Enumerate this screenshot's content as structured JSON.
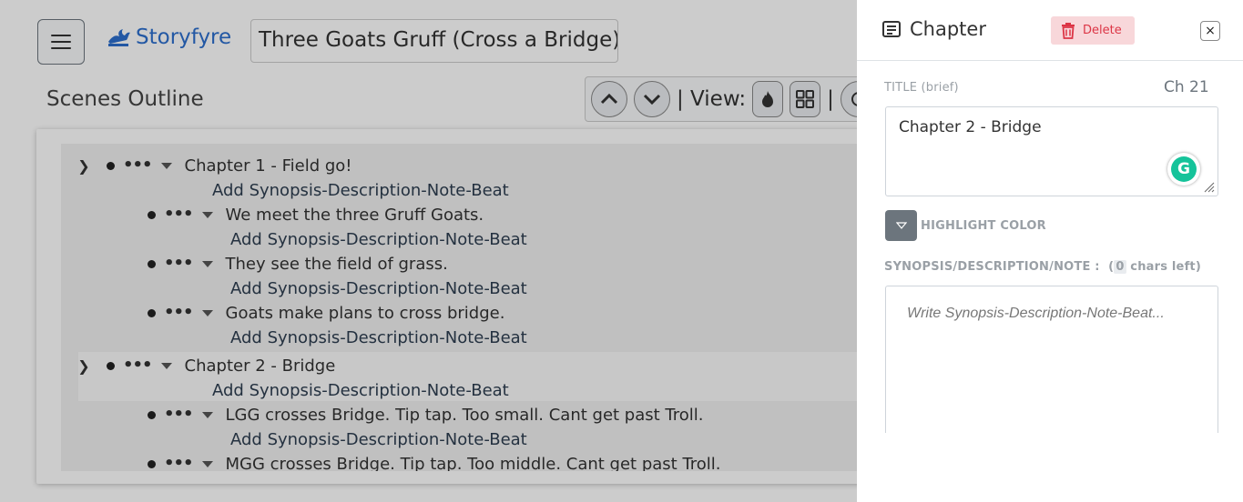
{
  "header": {
    "brand": "Storyfyre",
    "project_title": "Three Goats Gruff (Cross a Bridge)"
  },
  "outline": {
    "heading": "Scenes Outline",
    "toolbar_view_label": "| View:",
    "toolbar_sep": "|",
    "add_synopsis_label": "Add Synopsis-Description-Note-Beat",
    "chapters": [
      {
        "title": "Chapter 1 - Field go!",
        "add_label": "Add Synopsis-Description-Note-Beat",
        "scenes": [
          {
            "title": "We meet the three Gruff Goats.",
            "add_label": "Add Synopsis-Description-Note-Beat"
          },
          {
            "title": "They see the field of grass.",
            "add_label": "Add Synopsis-Description-Note-Beat"
          },
          {
            "title": "Goats make plans to cross bridge.",
            "add_label": "Add Synopsis-Description-Note-Beat"
          }
        ]
      },
      {
        "title": "Chapter 2 - Bridge",
        "add_label": "Add Synopsis-Description-Note-Beat",
        "scenes": [
          {
            "title": "LGG crosses Bridge. Tip tap. Too small. Cant get past Troll.",
            "add_label": "Add Synopsis-Description-Note-Beat"
          },
          {
            "title": "MGG crosses Bridge. Tip tap. Too middle. Cant get past Troll."
          }
        ]
      }
    ]
  },
  "panel": {
    "title": "Chapter",
    "delete_label": "Delete",
    "close_label": "×",
    "title_label": "TITLE (brief)",
    "chapter_number": "Ch 21",
    "title_value": "Chapter 2 - Bridge",
    "highlight_label": "HIGHLIGHT COLOR",
    "synopsis_label": "SYNOPSIS/DESCRIPTION/NOTE :",
    "chars_left_open": "(",
    "chars_left_count": "0",
    "chars_left_text": " chars left)",
    "synopsis_placeholder": "Write Synopsis-Description-Note-Beat...",
    "grammarly_letter": "G"
  },
  "colors": {
    "brand": "#2c6fce",
    "delete_bg": "#f8d7da",
    "delete_text": "#dc3545",
    "highlight_btn": "#6c757d",
    "grammarly": "#15c39a"
  }
}
